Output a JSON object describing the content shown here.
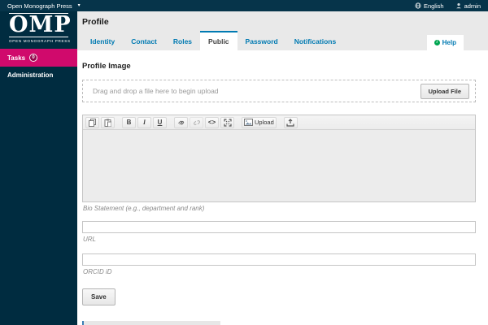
{
  "topbar": {
    "site_name": "Open Monograph Press",
    "caret": "▾",
    "language": "English",
    "user": "admin"
  },
  "sidebar": {
    "logo_text": "OMP",
    "logo_subtext": "OPEN MONOGRAPH PRESS",
    "items": [
      {
        "label": "Tasks",
        "badge": "0"
      },
      {
        "label": "Administration"
      }
    ]
  },
  "page": {
    "title": "Profile",
    "help_label": "Help",
    "help_glyph": "i"
  },
  "tabs": [
    {
      "label": "Identity",
      "active": false
    },
    {
      "label": "Contact",
      "active": false
    },
    {
      "label": "Roles",
      "active": false
    },
    {
      "label": "Public",
      "active": true
    },
    {
      "label": "Password",
      "active": false
    },
    {
      "label": "Notifications",
      "active": false
    }
  ],
  "form": {
    "section_title": "Profile Image",
    "dropzone_text": "Drag and drop a file here to begin upload",
    "upload_file_label": "Upload File",
    "save_label": "Save",
    "fields": [
      {
        "label": "Bio Statement (e.g., department and rank)",
        "value": ""
      },
      {
        "label": "URL",
        "value": ""
      },
      {
        "label": "ORCID iD",
        "value": ""
      }
    ]
  },
  "editor_toolbar": {
    "bold": "B",
    "italic": "I",
    "underline": "U",
    "code": "<>",
    "upload_label": "Upload"
  },
  "icons": {
    "globe": "globe-icon",
    "user": "user-icon",
    "copy": "copy-icon",
    "paste": "paste-icon",
    "link": "link-icon",
    "unlink": "unlink-icon",
    "fullscreen": "fullscreen-icon",
    "image": "image-icon",
    "upload_tray": "upload-tray-icon"
  },
  "colors": {
    "topbar_bg": "#06344a",
    "sidebar_bg": "#002c40",
    "tasks_bg": "#d00a6c",
    "accent_blue": "#007ab2",
    "help_green": "#00a651",
    "header_gray": "#e9e9e9",
    "editor_gray": "#ececec"
  }
}
